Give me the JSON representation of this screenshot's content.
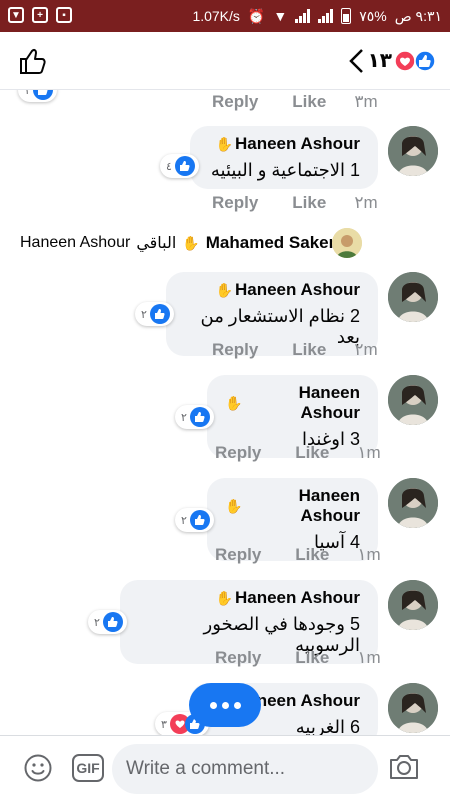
{
  "status_bar": {
    "time": "٩:٣١ ص",
    "battery": "٧٥%",
    "speed": "1.07K/s"
  },
  "header": {
    "reaction_count": "١٣",
    "reaction_icons": [
      "like-icon",
      "love-icon"
    ]
  },
  "top_meta": {
    "time": "٣m",
    "like": "Like",
    "reply": "Reply",
    "count": "١"
  },
  "reply_thread": {
    "replier_name": "Mahamed Saker",
    "remaining_label": "الباقي",
    "mention": "Haneen Ashour"
  },
  "comments": [
    {
      "author": "Haneen Ashour",
      "text": "1 الاجتماعية و البيئيه",
      "time": "٢m",
      "reply": "Reply",
      "like": "Like",
      "reactions": "٤",
      "icons": [
        "like-icon"
      ]
    },
    {
      "author": "Haneen Ashour",
      "text": "2 نظام الاستشعار من بعد",
      "time": "٢m",
      "reply": "Reply",
      "like": "Like",
      "reactions": "٢",
      "icons": [
        "like-icon"
      ]
    },
    {
      "author": "Haneen Ashour",
      "text": "3 اوغندا",
      "time": "١m",
      "reply": "Reply",
      "like": "Like",
      "reactions": "٢",
      "icons": [
        "like-icon"
      ]
    },
    {
      "author": "Haneen Ashour",
      "text": "4 آسيا",
      "time": "١m",
      "reply": "Reply",
      "like": "Like",
      "reactions": "٢",
      "icons": [
        "like-icon"
      ]
    },
    {
      "author": "Haneen Ashour",
      "text": "5 وجودها في الصخور الرسوبيه",
      "time": "١m",
      "reply": "Reply",
      "like": "Like",
      "reactions": "٢",
      "icons": [
        "like-icon"
      ]
    },
    {
      "author": "neen Ashour",
      "text": "6 الغربيه",
      "reactions": "٣",
      "icons": [
        "love-icon",
        "like-icon"
      ]
    }
  ],
  "composer": {
    "placeholder": "Write a comment...",
    "gif_label": "GIF"
  },
  "colors": {
    "status_bar": "#7a1f1f",
    "accent_blue": "#1877f2",
    "love_red": "#f33e58",
    "bubble": "#f0f2f5",
    "meta_text": "#8a8d91"
  }
}
